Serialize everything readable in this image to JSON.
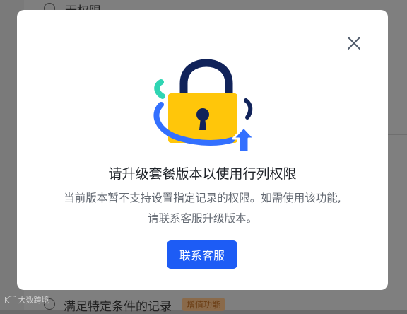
{
  "background": {
    "top_option_label": "无权限",
    "bottom_option_label": "满足特定条件的记录",
    "bottom_option_badge": "增值功能",
    "watermark": "大数跨境"
  },
  "modal": {
    "close_icon": "close-icon",
    "illustration_icon": "padlock-upgrade-icon",
    "title": "请升级套餐版本以使用行列权限",
    "description_line1": "当前版本暂不支持设置指定记录的权限。如需使用该功能,",
    "description_line2": "请联系客服升级版本。",
    "contact_button_label": "联系客服"
  },
  "colors": {
    "primary": "#1d5cf5",
    "lock_body": "#ffc60a",
    "lock_shackle": "#11235a",
    "accent_teal": "#2fd5b3",
    "arrow": "#3370ff"
  }
}
